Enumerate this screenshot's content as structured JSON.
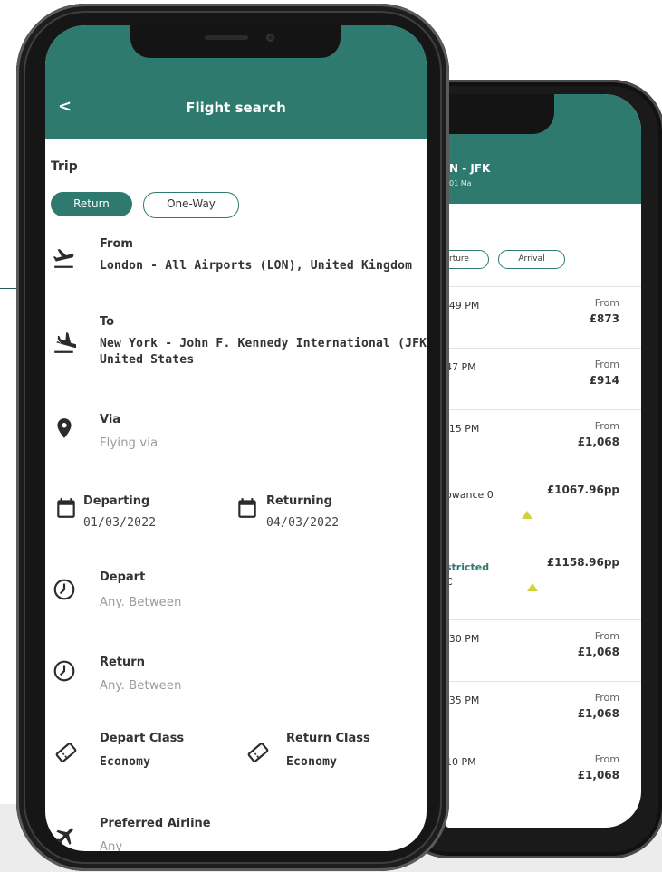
{
  "front": {
    "header_title": "Flight search",
    "back_icon": "<",
    "trip_label": "Trip",
    "trip_options": [
      "Return",
      "One-Way"
    ],
    "from": {
      "label": "From",
      "value": "London - All Airports (LON), United Kingdom"
    },
    "to": {
      "label": "To",
      "value_line1": "New York - John F. Kennedy International (JFK",
      "value_line2": "United States"
    },
    "via": {
      "label": "Via",
      "placeholder": "Flying via"
    },
    "departing": {
      "label": "Departing",
      "value": "01/03/2022"
    },
    "returning": {
      "label": "Returning",
      "value": "04/03/2022"
    },
    "depart_time": {
      "label": "Depart",
      "value": "Any. Between"
    },
    "return_time": {
      "label": "Return",
      "value": "Any. Between"
    },
    "depart_class": {
      "label": "Depart Class",
      "value": "Economy"
    },
    "return_class": {
      "label": "Return Class",
      "value": "Economy"
    },
    "preferred_airline": {
      "label": "Preferred Airline",
      "value": "Any"
    }
  },
  "back": {
    "route_title": "N - JFK",
    "route_sub": "01 Ma",
    "sort_options": [
      "rture",
      "Arrival"
    ],
    "results": [
      {
        "time": ":49 PM",
        "from": "From",
        "price": "£873"
      },
      {
        "time": "47 PM",
        "from": "From",
        "price": "£914"
      },
      {
        "time": ":15 PM",
        "from": "From",
        "price": "£1,068"
      },
      {
        "fare": "owance 0",
        "price": "£1067.96pp"
      },
      {
        "fare": "stricted",
        "sub": "C",
        "price": "£1158.96pp"
      },
      {
        "time": ":30 PM",
        "from": "From",
        "price": "£1,068"
      },
      {
        "time": ":35 PM",
        "from": "From",
        "price": "£1,068"
      },
      {
        "time": "10 PM",
        "from": "From",
        "price": "£1,068"
      }
    ]
  },
  "colors": {
    "brand": "#2e7a6e",
    "marker": "#d2d23a"
  }
}
